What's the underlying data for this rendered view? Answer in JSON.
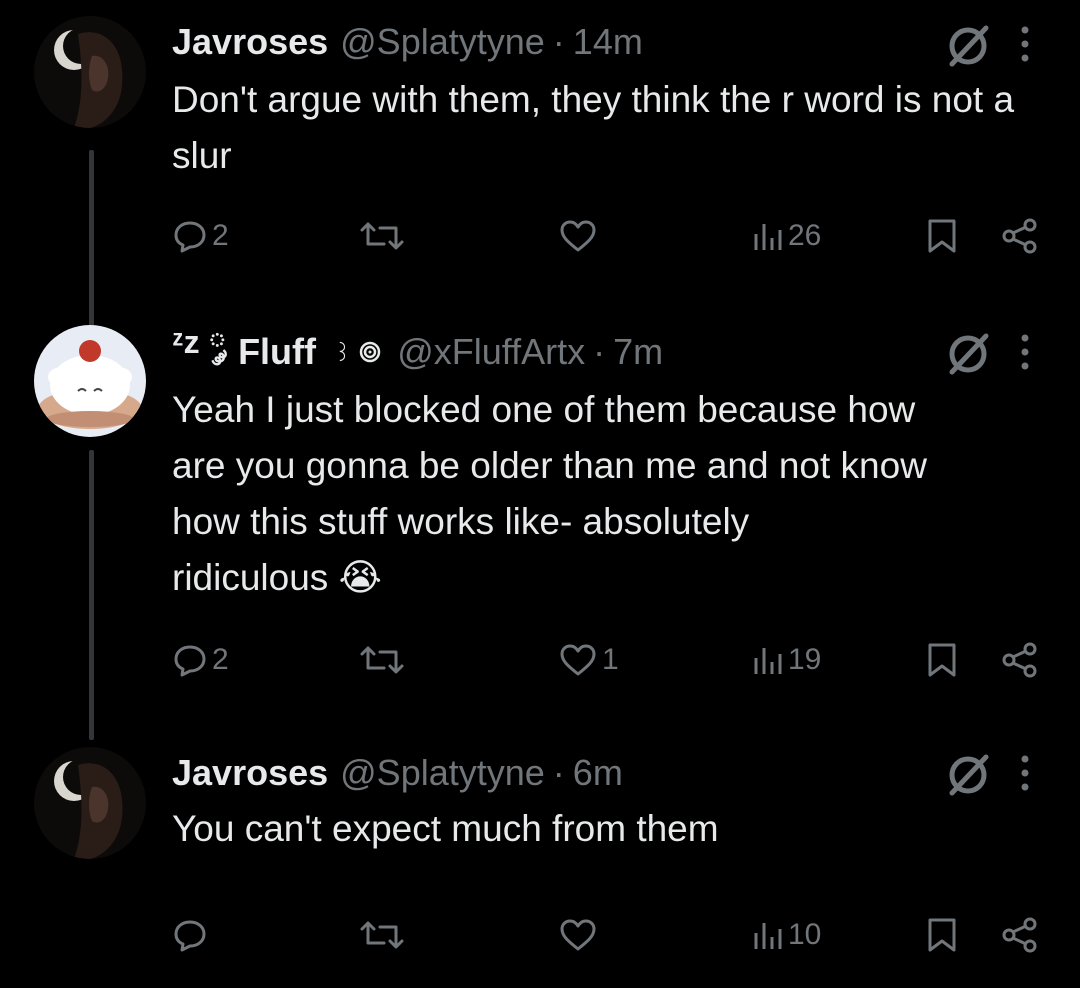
{
  "tweets": [
    {
      "name": "Javroses",
      "handle": "@Splatytyne",
      "separator": "·",
      "time": "14m",
      "text": "Don't argue with them, they think the r word is not a slur",
      "stats": {
        "replies": "2",
        "reposts": "",
        "likes": "",
        "views": "26"
      }
    },
    {
      "name_prefix": "ᶻz ༘",
      "name": "Fluff",
      "name_suffix": "꒱",
      "handle": "@xFluffArtx",
      "separator": "·",
      "time": "7m",
      "text_lines": [
        "Yeah I just blocked one of them because how",
        "are you gonna be older than me and not know",
        "how this stuff works like- absolutely",
        "ridiculous"
      ],
      "emoji": "😭",
      "stats": {
        "replies": "2",
        "reposts": "",
        "likes": "1",
        "views": "19"
      }
    },
    {
      "name": "Javroses",
      "handle": "@Splatytyne",
      "separator": "·",
      "time": "6m",
      "text": "You can't expect much from them",
      "stats": {
        "replies": "",
        "reposts": "",
        "likes": "",
        "views": "10"
      }
    }
  ],
  "icons": [
    "reply-icon",
    "repost-icon",
    "like-icon",
    "views-icon",
    "bookmark-icon",
    "share-icon",
    "grok-icon",
    "more-icon"
  ],
  "colors": {
    "background": "#000000",
    "text": "#e7e9ea",
    "muted": "#71767b",
    "thread_line": "#333639"
  }
}
